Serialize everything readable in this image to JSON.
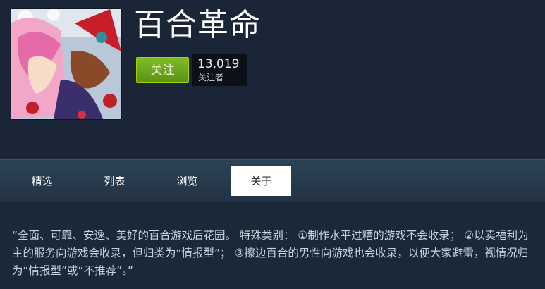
{
  "group": {
    "title": "百合革命",
    "follow_label": "关注",
    "follower_count": "13,019",
    "follower_label": "关注者"
  },
  "nav": {
    "tabs": [
      {
        "label": "精选",
        "active": false
      },
      {
        "label": "列表",
        "active": false
      },
      {
        "label": "浏览",
        "active": false
      },
      {
        "label": "关于",
        "active": true
      }
    ]
  },
  "about": {
    "description": "“全面、可靠、安逸、美好的百合游戏后花园。 特殊类别：  ①制作水平过糟的游戏不会收录；  ②以卖福利为主的服务向游戏会收录，但归类为“情报型”；  ③擦边百合的男性向游戏也会收录，以便大家避雷，视情况归为“情报型”或“不推荐”。”"
  },
  "colors": {
    "page_bg": "#1b2838",
    "follow_button": "#5c9318",
    "nav_bg": "#2a475e",
    "active_tab_bg": "#ffffff"
  }
}
